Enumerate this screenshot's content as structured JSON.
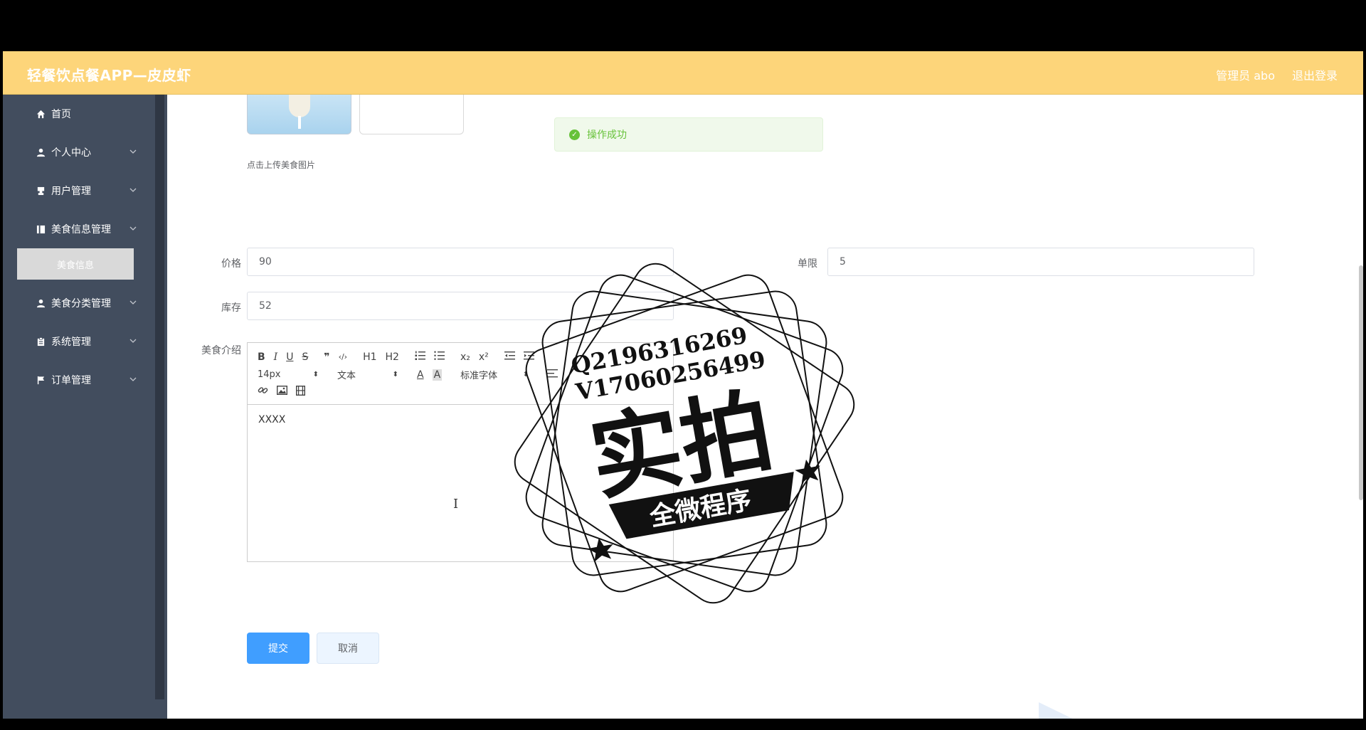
{
  "header": {
    "app_title": "轻餐饮点餐APP—皮皮虾",
    "admin_label": "管理员 abo",
    "logout_label": "退出登录"
  },
  "toast": {
    "message": "操作成功",
    "icon": "check-circle-icon",
    "color": "#67c23a"
  },
  "sidebar": {
    "items": [
      {
        "label": "首页",
        "icon": "home-icon"
      },
      {
        "label": "个人中心",
        "icon": "user-icon"
      },
      {
        "label": "用户管理",
        "icon": "stamp-icon"
      },
      {
        "label": "美食信息管理",
        "icon": "book-icon"
      },
      {
        "label": "美食分类管理",
        "icon": "user-icon"
      },
      {
        "label": "系统管理",
        "icon": "clipboard-icon"
      },
      {
        "label": "订单管理",
        "icon": "flag-icon"
      }
    ],
    "active_sub_item": "美食信息"
  },
  "form": {
    "upload_hint": "点击上传美食图片",
    "price": {
      "label": "价格",
      "value": "90"
    },
    "limit": {
      "label": "单限",
      "value": "5"
    },
    "stock": {
      "label": "库存",
      "value": "52"
    },
    "intro": {
      "label": "美食介绍",
      "content": "XXXX"
    }
  },
  "editor": {
    "toolbar_row1": [
      "B",
      "I",
      "U",
      "S",
      "❞",
      "‹/›",
      "H1",
      "H2",
      "list-ordered-icon",
      "list-bullet-icon",
      "x₂",
      "x²",
      "indent-decrease-icon",
      "indent-increase-icon"
    ],
    "font_size": "14px",
    "block_type": "文本",
    "font_family": "标准字体",
    "toolbar_row3": [
      "link-icon",
      "image-icon",
      "video-icon"
    ]
  },
  "buttons": {
    "submit": "提交",
    "cancel": "取消"
  },
  "watermark": {
    "line1": "Q2196316269",
    "line2": "V17060256499",
    "big": "实拍",
    "banner": "全微程序"
  },
  "colors": {
    "header_bg": "#fdd57a",
    "sidebar_bg": "#424d5e",
    "primary": "#409eff",
    "success": "#67c23a"
  }
}
